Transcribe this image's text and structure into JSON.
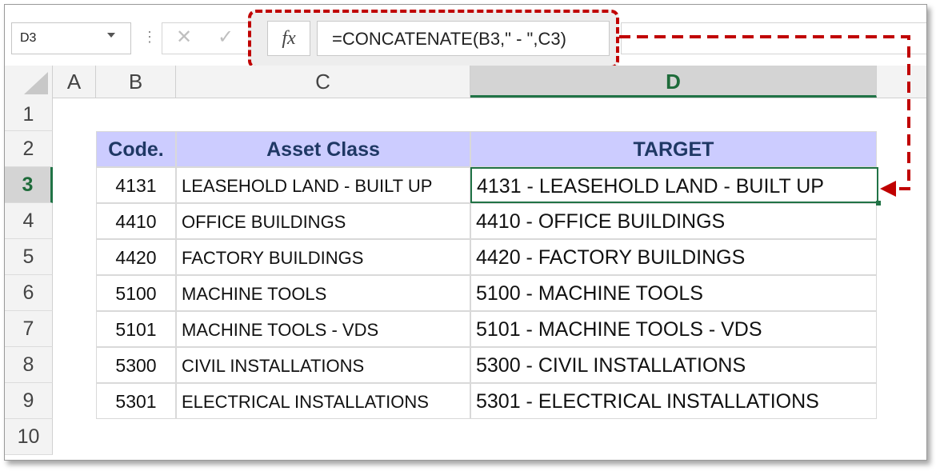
{
  "formula_bar": {
    "name_box": "D3",
    "cancel_glyph": "✕",
    "enter_glyph": "✓",
    "fx_label": "fx",
    "formula": "=CONCATENATE(B3,\" - \",C3)"
  },
  "columns": [
    "A",
    "B",
    "C",
    "D"
  ],
  "selected_column": "D",
  "rows": [
    "1",
    "2",
    "3",
    "4",
    "5",
    "6",
    "7",
    "8",
    "9",
    "10"
  ],
  "selected_row": "3",
  "table": {
    "headers": [
      "Code.",
      "Asset Class",
      "TARGET"
    ],
    "rows": [
      {
        "code": "4131",
        "asset": "LEASEHOLD LAND - BUILT UP",
        "target": "4131 - LEASEHOLD LAND - BUILT UP"
      },
      {
        "code": "4410",
        "asset": "OFFICE BUILDINGS",
        "target": "4410 - OFFICE BUILDINGS"
      },
      {
        "code": "4420",
        "asset": "FACTORY BUILDINGS",
        "target": "4420 - FACTORY BUILDINGS"
      },
      {
        "code": "5100",
        "asset": "MACHINE TOOLS",
        "target": "5100 - MACHINE TOOLS"
      },
      {
        "code": "5101",
        "asset": "MACHINE TOOLS - VDS",
        "target": "5101 - MACHINE TOOLS - VDS"
      },
      {
        "code": "5300",
        "asset": "CIVIL INSTALLATIONS",
        "target": "5300 - CIVIL INSTALLATIONS"
      },
      {
        "code": "5301",
        "asset": "ELECTRICAL INSTALLATIONS",
        "target": "5301 - ELECTRICAL INSTALLATIONS"
      }
    ]
  },
  "colors": {
    "header_fill": "#ccccff",
    "header_text": "#1f3864",
    "accent_green": "#217346",
    "callout_red": "#c00000"
  }
}
